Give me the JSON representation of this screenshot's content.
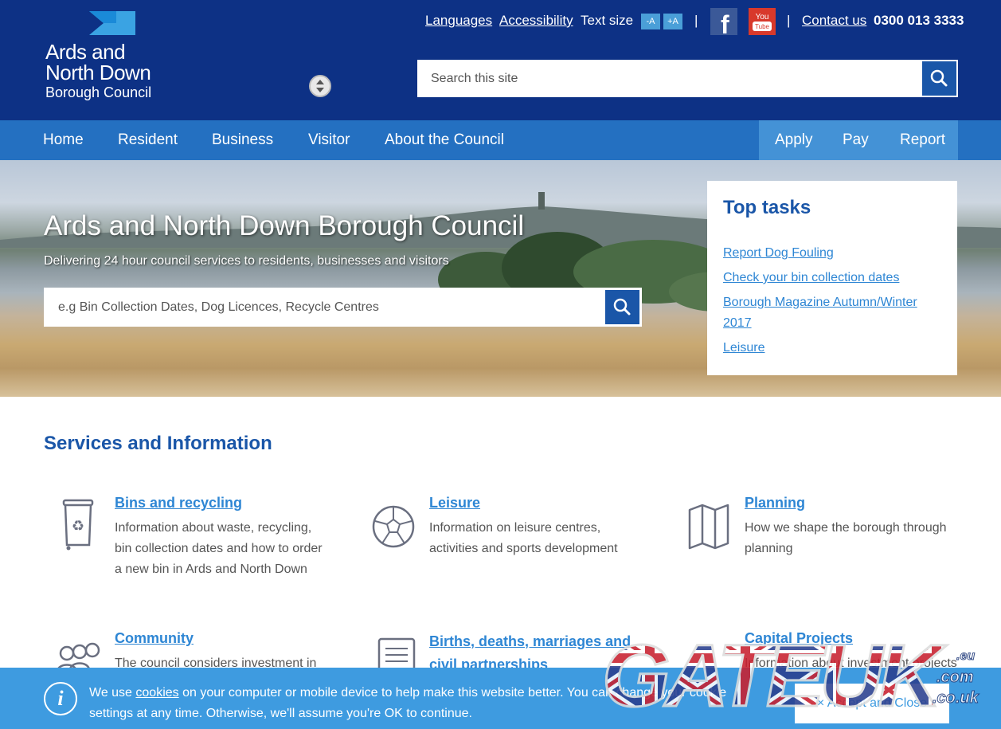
{
  "header": {
    "logo_lines": [
      "Ards and",
      "North Down",
      "Borough Council"
    ],
    "util_links": {
      "languages": "Languages",
      "accessibility": "Accessibility",
      "text_size_label": "Text size",
      "text_size_minus": "-A",
      "text_size_plus": "+A",
      "separator": "|",
      "contact": "Contact us",
      "phone": "0300 013 3333"
    },
    "social": {
      "facebook": "f",
      "youtube_top": "You",
      "youtube_bottom": "Tube"
    },
    "search": {
      "placeholder": "Search this site"
    }
  },
  "nav": {
    "items": [
      "Home",
      "Resident",
      "Business",
      "Visitor",
      "About the Council"
    ],
    "actions": [
      "Apply",
      "Pay",
      "Report"
    ]
  },
  "hero": {
    "title": "Ards and North Down Borough Council",
    "subtitle": "Delivering 24 hour council services to residents, businesses and visitors",
    "search_placeholder": "e.g Bin Collection Dates, Dog Licences, Recycle Centres"
  },
  "top_tasks": {
    "title": "Top tasks",
    "links": [
      "Report Dog Fouling",
      "Check your bin collection dates",
      "Borough Magazine Autumn/Winter 2017",
      "Leisure"
    ]
  },
  "services": {
    "title": "Services and Information",
    "items": [
      {
        "title": "Bins and recycling",
        "desc": "Information about waste, recycling, bin collection dates and how to order a new bin in Ards and North Down"
      },
      {
        "title": "Leisure",
        "desc": "Information on leisure centres, activities and sports development"
      },
      {
        "title": "Planning",
        "desc": "How we shape the borough through planning"
      },
      {
        "title": "Community",
        "desc": "The council considers investment in"
      },
      {
        "title": "Births, deaths, marriages and civil partnerships",
        "desc": ""
      },
      {
        "title": "Capital Projects",
        "desc": "Information about investment projects"
      }
    ]
  },
  "cookie": {
    "info_glyph": "i",
    "text_before": "We use ",
    "link": "cookies",
    "text_after": " on your computer or mobile device to help make this website better. You can change your cookie settings at any time. Otherwise, we'll assume you're OK to continue.",
    "button": "× Accept and Close"
  },
  "watermark": {
    "main": "GATEUK",
    "suffix_top": ".com",
    "suffix_bottom": ".co.uk",
    "small": ".eu"
  },
  "colors": {
    "header_bg": "#0d3185",
    "nav_bg": "#2470c1",
    "nav_actions_bg": "#4492d6",
    "accent_dark": "#1a56a8",
    "link": "#2e86d4",
    "cookie_bg": "#3e9be0"
  }
}
